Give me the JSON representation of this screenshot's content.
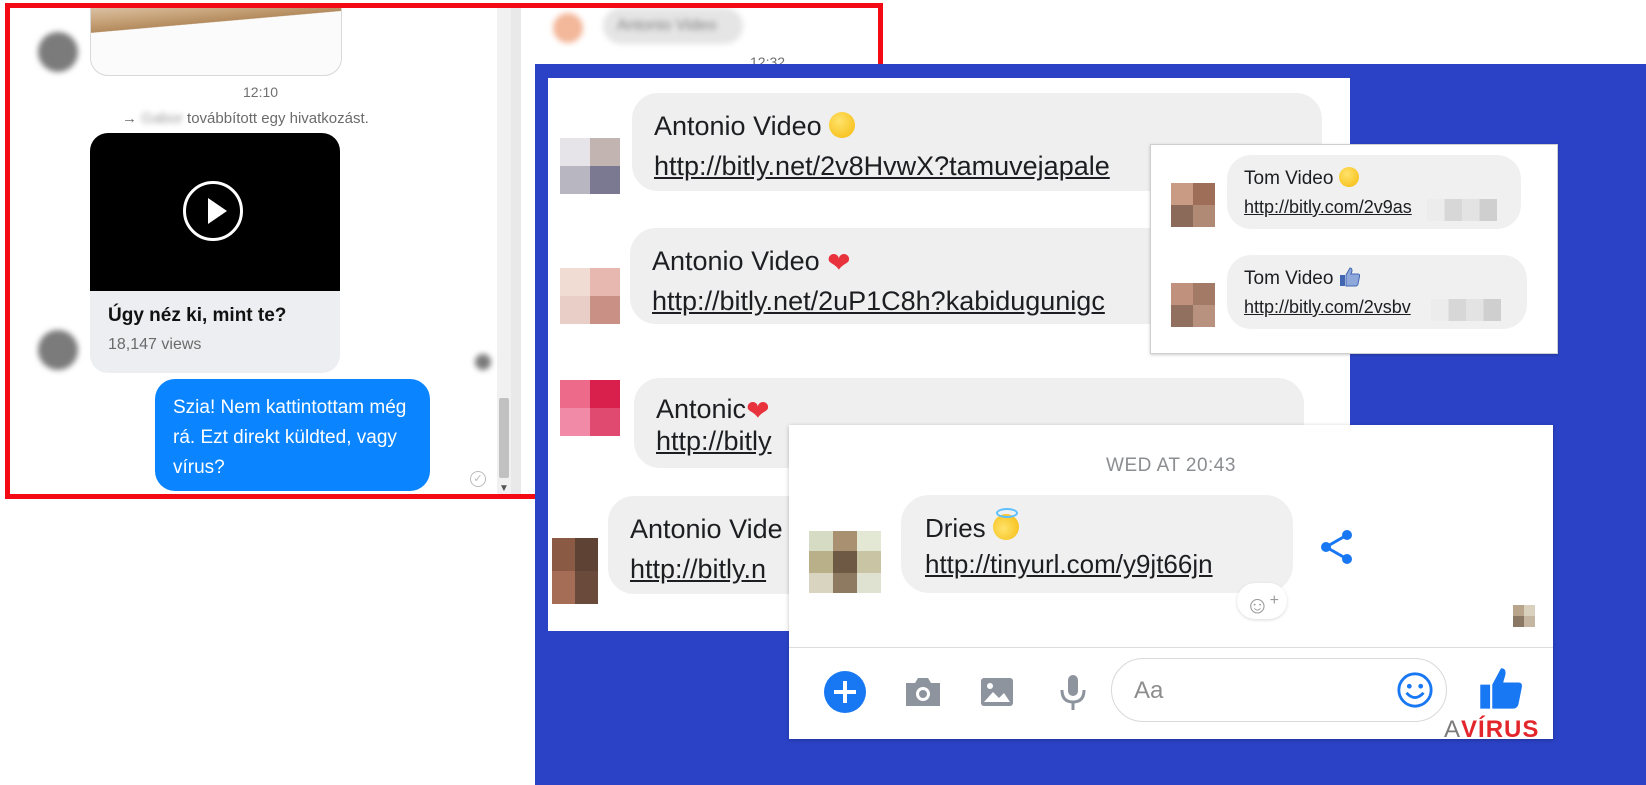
{
  "shot1": {
    "time_1": "12:10",
    "time_2": "12:32",
    "forward_sender": "Gabor",
    "forward_text": "továbbított egy hivatkozást.",
    "video_title": "Úgy néz ki, mint te?",
    "video_views": "18,147 views",
    "reply_text": "Szia! Nem kattintottam még rá. Ezt direkt küldted, vagy vírus?",
    "top_right_blurred": "Antonio Video"
  },
  "antonio_panel": {
    "messages": [
      {
        "name": "Antonio Video",
        "emoji": "smile-icon",
        "link": "http://bitly.net/2v8HvwX?tamuvejapale"
      },
      {
        "name": "Antonio Video",
        "emoji": "heart-icon",
        "link": "http://bitly.net/2uP1C8h?kabidugunigc"
      },
      {
        "name": "Antonic",
        "emoji": "heart-icon",
        "link": "http://bitly"
      },
      {
        "name": "Antonio Vide",
        "emoji": "",
        "link": "http://bitly.n"
      }
    ]
  },
  "tom_panel": {
    "messages": [
      {
        "name": "Tom Video",
        "emoji": "smile-icon",
        "link": "http://bitly.com/2v9as"
      },
      {
        "name": "Tom Video",
        "emoji": "thumbs-up-icon",
        "link": "http://bitly.com/2vsbv"
      }
    ]
  },
  "dries_panel": {
    "date": "WED AT 20:43",
    "name": "Dries",
    "emoji": "halo-smile-icon",
    "link": "http://tinyurl.com/y9jt66jn",
    "input_placeholder": "Aa"
  },
  "watermark": {
    "prefix": "A",
    "text": "VÍRUS"
  },
  "colors": {
    "red_border": "#f40a14",
    "blue_background": "#2b42c6",
    "messenger_blue": "#0a84ff",
    "fb_blue": "#1877f2"
  }
}
